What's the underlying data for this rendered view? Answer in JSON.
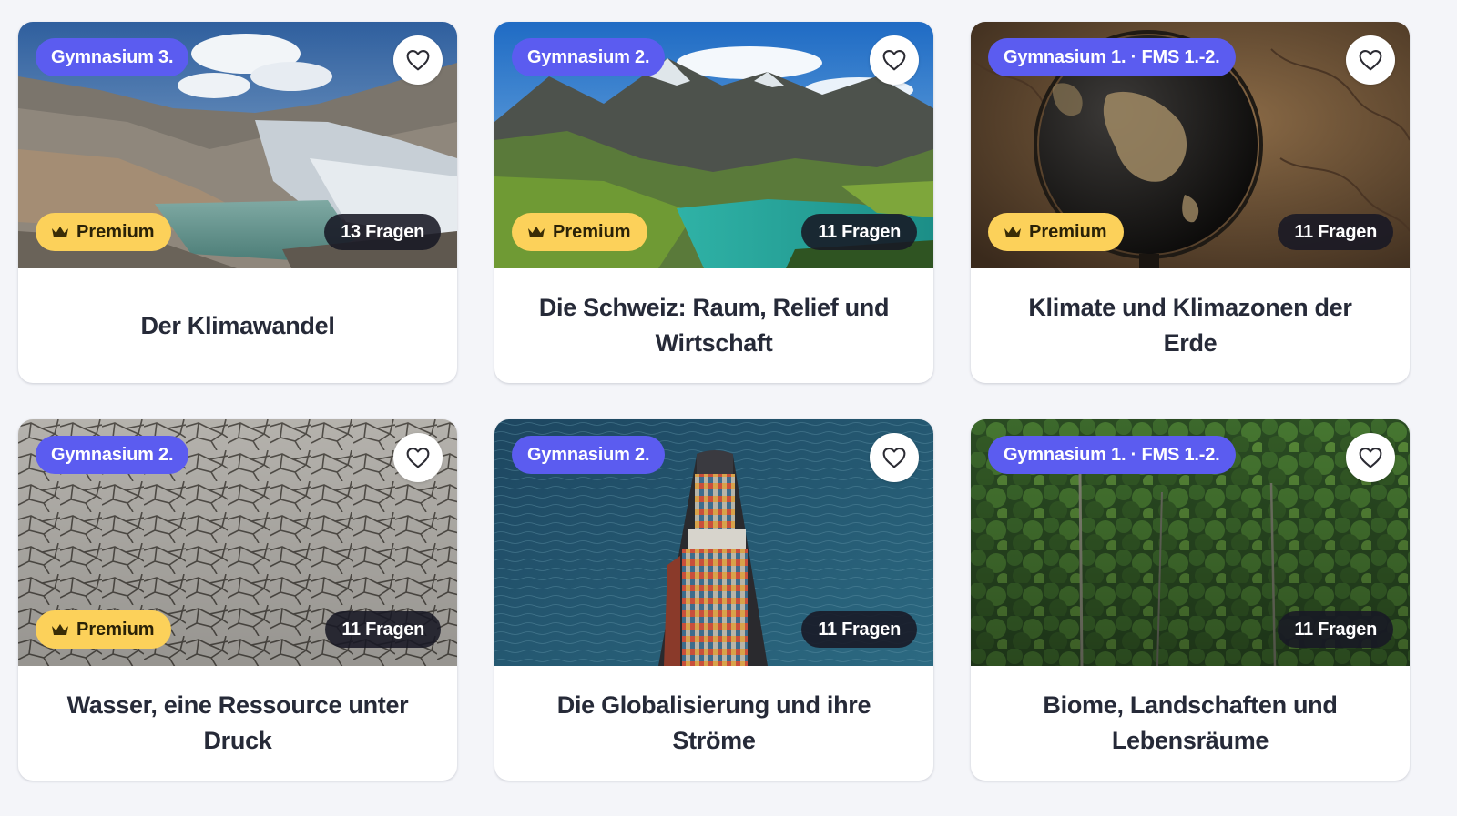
{
  "cards": [
    {
      "title": "Der Klimawandel",
      "level": "Gymnasium 3.",
      "premium_label": "Premium",
      "question_count": "13 Fragen",
      "image": "glacier-landscape",
      "favorite_icon": "heart-outline-icon"
    },
    {
      "title": "Die Schweiz: Raum, Relief und Wirtschaft",
      "level": "Gymnasium 2.",
      "premium_label": "Premium",
      "question_count": "11 Fragen",
      "image": "alpine-lake",
      "favorite_icon": "heart-outline-icon"
    },
    {
      "title": "Klimate und Klimazonen der Erde",
      "level": "Gymnasium 1. · FMS 1.-2.",
      "premium_label": "Premium",
      "question_count": "11 Fragen",
      "image": "globe-and-map",
      "favorite_icon": "heart-outline-icon"
    },
    {
      "title": "Wasser, eine Ressource unter Druck",
      "level": "Gymnasium 2.",
      "premium_label": "Premium",
      "question_count": "11 Fragen",
      "image": "cracked-dry-earth",
      "favorite_icon": "heart-outline-icon"
    },
    {
      "title": "Die Globalisierung und ihre Ströme",
      "level": "Gymnasium 2.",
      "premium_label": "",
      "question_count": "11 Fragen",
      "image": "container-ship",
      "favorite_icon": "heart-outline-icon"
    },
    {
      "title": "Biome, Landschaften und Lebensräume",
      "level": "Gymnasium 1. · FMS 1.-2.",
      "premium_label": "",
      "question_count": "11 Fragen",
      "image": "rainforest-canopy",
      "favorite_icon": "heart-outline-icon"
    }
  ],
  "colors": {
    "level_badge": "#5b5cf0",
    "premium_badge": "#fcd15a",
    "count_badge": "#18182a",
    "title_text": "#262a38",
    "page_background": "#f4f5f9"
  }
}
